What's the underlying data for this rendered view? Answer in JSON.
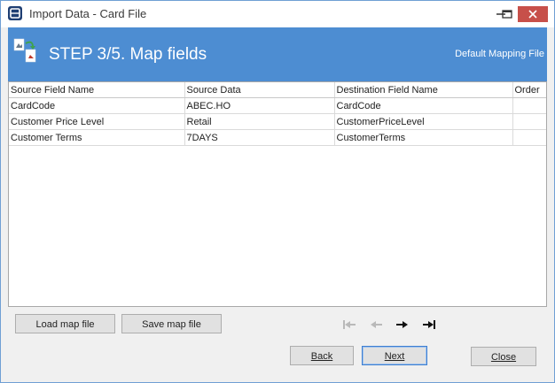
{
  "window": {
    "title": "Import Data - Card File"
  },
  "header": {
    "step_title": "STEP 3/5. Map fields",
    "default_mapping": "Default Mapping File"
  },
  "grid": {
    "columns": [
      "Source Field Name",
      "Source Data",
      "Destination Field Name",
      "Order"
    ],
    "rows": [
      [
        "CardCode",
        "ABEC.HO",
        "CardCode",
        ""
      ],
      [
        "Customer Price Level",
        "Retail",
        "CustomerPriceLevel",
        ""
      ],
      [
        "Customer Terms",
        "7DAYS",
        "CustomerTerms",
        ""
      ]
    ]
  },
  "buttons": {
    "load_map": "Load map file",
    "save_map": "Save map file",
    "back": "Back",
    "next": "Next",
    "close": "Close"
  },
  "icons": {
    "first": "first-record-icon",
    "prev": "previous-record-icon",
    "next": "next-record-icon",
    "last": "last-record-icon"
  },
  "colors": {
    "header_band": "#4d8dd2",
    "close_button": "#c7504a",
    "window_border": "#6f9fd4"
  }
}
